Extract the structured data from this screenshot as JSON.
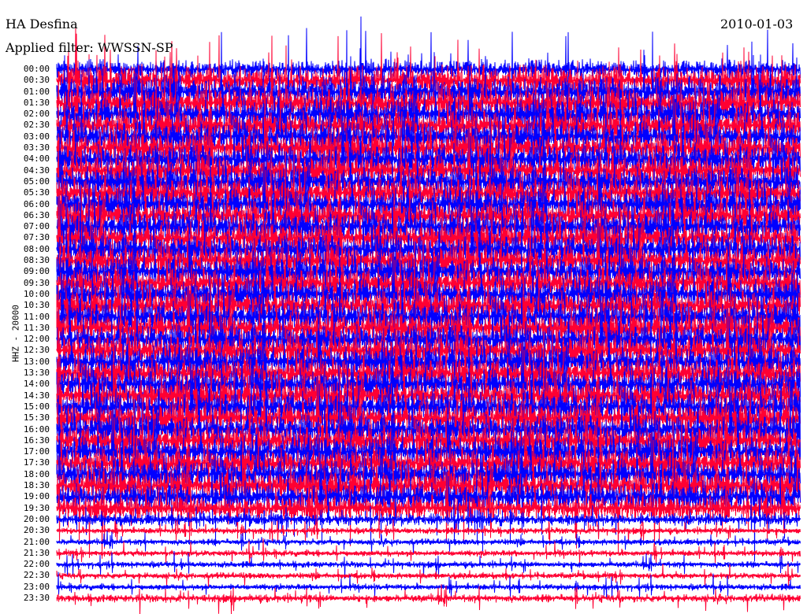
{
  "header": {
    "station": "HA Desfina",
    "filter": "Applied filter: WWSSN-SP",
    "date": "2010-01-03"
  },
  "chart_data": {
    "type": "line",
    "title": "HA Desfina",
    "subtitle": "Applied filter: WWSSN-SP",
    "date": "2010-01-03",
    "ylabel": "HHZ - 20000",
    "xlabel": "",
    "series_colors": [
      "#0000ff",
      "#ff0033"
    ],
    "rows": [
      "00:00",
      "00:30",
      "01:00",
      "01:30",
      "02:00",
      "02:30",
      "03:00",
      "03:30",
      "04:00",
      "04:30",
      "05:00",
      "05:30",
      "06:00",
      "06:30",
      "07:00",
      "07:30",
      "08:00",
      "08:30",
      "09:00",
      "09:30",
      "10:00",
      "10:30",
      "11:00",
      "11:30",
      "12:00",
      "12:30",
      "13:00",
      "13:30",
      "14:00",
      "14:30",
      "15:00",
      "15:30",
      "16:00",
      "16:30",
      "17:00",
      "17:30",
      "18:00",
      "18:30",
      "19:00",
      "19:30",
      "20:00",
      "20:30",
      "21:00",
      "21:30",
      "22:00",
      "22:30",
      "23:00",
      "23:30"
    ],
    "relative_amplitude": [
      0.6,
      0.9,
      1,
      1,
      1,
      1,
      1,
      1,
      1,
      1,
      1,
      1,
      1,
      1,
      1,
      1,
      1,
      1,
      1,
      1,
      1,
      1,
      1,
      1,
      1,
      1,
      1,
      1,
      1,
      1,
      1,
      1,
      1,
      1,
      1,
      1,
      1,
      1,
      0.9,
      0.8,
      0.4,
      0.2,
      0.2,
      0.2,
      0.2,
      0.2,
      0.2,
      0.25
    ]
  }
}
